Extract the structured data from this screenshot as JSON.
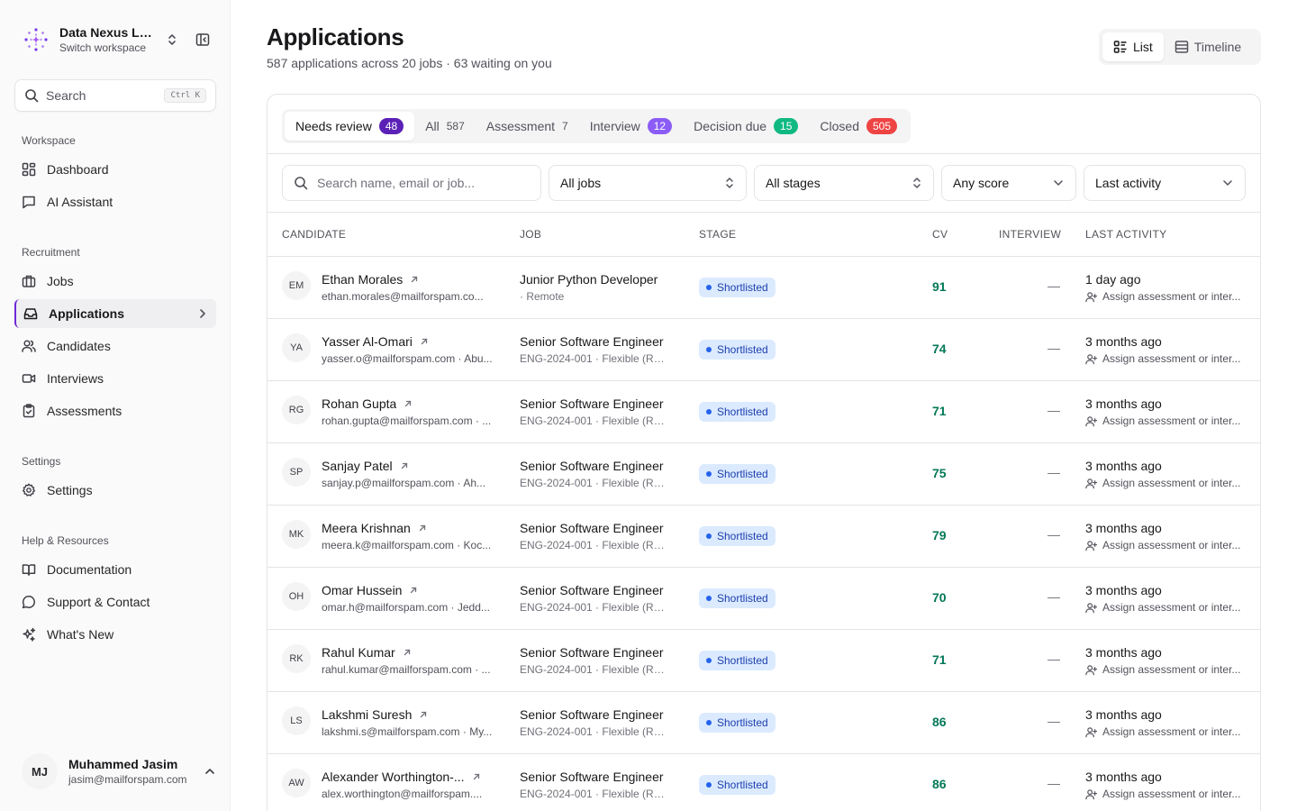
{
  "sidebar": {
    "workspace": {
      "name": "Data Nexus Labs",
      "sub": "Switch workspace"
    },
    "search": {
      "label": "Search",
      "shortcut": "Ctrl K"
    },
    "sections": {
      "workspace": "Workspace",
      "recruitment": "Recruitment",
      "settings": "Settings",
      "help": "Help & Resources"
    },
    "nav": {
      "dashboard": "Dashboard",
      "ai_assistant": "AI Assistant",
      "jobs": "Jobs",
      "applications": "Applications",
      "candidates": "Candidates",
      "interviews": "Interviews",
      "assessments": "Assessments",
      "settings": "Settings",
      "documentation": "Documentation",
      "support": "Support & Contact",
      "whats_new": "What's New"
    },
    "user": {
      "initials": "MJ",
      "name": "Muhammed Jasim",
      "email": "jasim@mailforspam.com"
    }
  },
  "header": {
    "title": "Applications",
    "subtitle": "587 applications across 20 jobs · 63 waiting on you",
    "view_toggle": {
      "list": "List",
      "timeline": "Timeline",
      "active": "list"
    }
  },
  "tabs": [
    {
      "label": "Needs review",
      "count": "48",
      "style": "badge",
      "color": "#5b21b6",
      "active": true
    },
    {
      "label": "All",
      "count": "587",
      "style": "plain",
      "active": false
    },
    {
      "label": "Assessment",
      "count": "7",
      "style": "plain",
      "active": false
    },
    {
      "label": "Interview",
      "count": "12",
      "style": "badge",
      "color": "#8b5cf6",
      "active": false
    },
    {
      "label": "Decision due",
      "count": "15",
      "style": "badge",
      "color": "#10b981",
      "active": false
    },
    {
      "label": "Closed",
      "count": "505",
      "style": "badge",
      "color": "#ef4444",
      "active": false
    }
  ],
  "filters": {
    "search_placeholder": "Search name, email or job...",
    "jobs": "All jobs",
    "stages": "All stages",
    "score": "Any score",
    "sort": "Last activity"
  },
  "table": {
    "columns": {
      "candidate": "CANDIDATE",
      "job": "JOB",
      "stage": "STAGE",
      "cv": "CV",
      "interview": "INTERVIEW",
      "last_activity": "LAST ACTIVITY"
    },
    "rows": [
      {
        "initials": "EM",
        "name": "Ethan Morales",
        "email": "ethan.morales@mailforspam.co...",
        "job": "Junior Python Developer",
        "job_sub": "· Remote",
        "stage": "Shortlisted",
        "cv": "91",
        "interview": "—",
        "activity": "1 day ago",
        "activity_sub": "Assign assessment or inter..."
      },
      {
        "initials": "YA",
        "name": "Yasser Al-Omari",
        "email": "yasser.o@mailforspam.com · Abu...",
        "job": "Senior Software Engineer",
        "job_sub": "ENG-2024-001 · Flexible (Re...",
        "stage": "Shortlisted",
        "cv": "74",
        "interview": "—",
        "activity": "3 months ago",
        "activity_sub": "Assign assessment or inter..."
      },
      {
        "initials": "RG",
        "name": "Rohan Gupta",
        "email": "rohan.gupta@mailforspam.com · ...",
        "job": "Senior Software Engineer",
        "job_sub": "ENG-2024-001 · Flexible (Re...",
        "stage": "Shortlisted",
        "cv": "71",
        "interview": "—",
        "activity": "3 months ago",
        "activity_sub": "Assign assessment or inter..."
      },
      {
        "initials": "SP",
        "name": "Sanjay Patel",
        "email": "sanjay.p@mailforspam.com · Ah...",
        "job": "Senior Software Engineer",
        "job_sub": "ENG-2024-001 · Flexible (Re...",
        "stage": "Shortlisted",
        "cv": "75",
        "interview": "—",
        "activity": "3 months ago",
        "activity_sub": "Assign assessment or inter..."
      },
      {
        "initials": "MK",
        "name": "Meera Krishnan",
        "email": "meera.k@mailforspam.com · Koc...",
        "job": "Senior Software Engineer",
        "job_sub": "ENG-2024-001 · Flexible (Re...",
        "stage": "Shortlisted",
        "cv": "79",
        "interview": "—",
        "activity": "3 months ago",
        "activity_sub": "Assign assessment or inter..."
      },
      {
        "initials": "OH",
        "name": "Omar Hussein",
        "email": "omar.h@mailforspam.com · Jedd...",
        "job": "Senior Software Engineer",
        "job_sub": "ENG-2024-001 · Flexible (Re...",
        "stage": "Shortlisted",
        "cv": "70",
        "interview": "—",
        "activity": "3 months ago",
        "activity_sub": "Assign assessment or inter..."
      },
      {
        "initials": "RK",
        "name": "Rahul Kumar",
        "email": "rahul.kumar@mailforspam.com · ...",
        "job": "Senior Software Engineer",
        "job_sub": "ENG-2024-001 · Flexible (Re...",
        "stage": "Shortlisted",
        "cv": "71",
        "interview": "—",
        "activity": "3 months ago",
        "activity_sub": "Assign assessment or inter..."
      },
      {
        "initials": "LS",
        "name": "Lakshmi Suresh",
        "email": "lakshmi.s@mailforspam.com · My...",
        "job": "Senior Software Engineer",
        "job_sub": "ENG-2024-001 · Flexible (Re...",
        "stage": "Shortlisted",
        "cv": "86",
        "interview": "—",
        "activity": "3 months ago",
        "activity_sub": "Assign assessment or inter..."
      },
      {
        "initials": "AW",
        "name": "Alexander Worthington-...",
        "email": "alex.worthington@mailforspam....",
        "job": "Senior Software Engineer",
        "job_sub": "ENG-2024-001 · Flexible (Re...",
        "stage": "Shortlisted",
        "cv": "86",
        "interview": "—",
        "activity": "3 months ago",
        "activity_sub": "Assign assessment or inter..."
      }
    ]
  },
  "colors": {
    "accent": "#6d28d9",
    "stage_bg": "#dbeafe",
    "stage_text": "#1e40af",
    "cv_score": "#047857"
  }
}
